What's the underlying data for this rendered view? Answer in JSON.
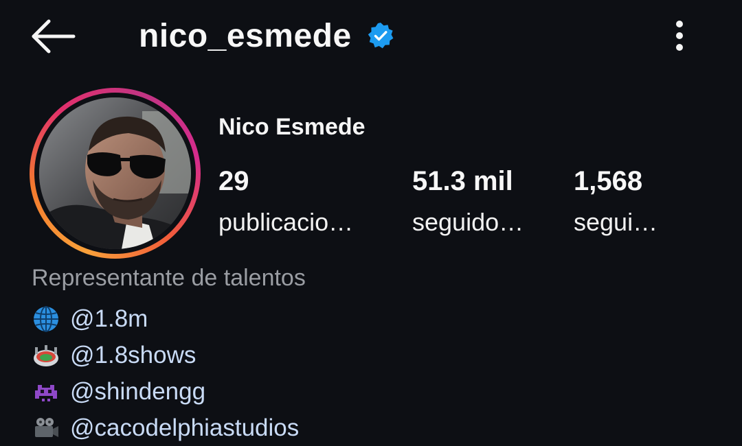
{
  "header": {
    "username": "nico_esmede"
  },
  "profile": {
    "display_name": "Nico Esmede",
    "category": "Representante de talentos"
  },
  "stats": [
    {
      "count": "29",
      "label": "publicacio…"
    },
    {
      "count": "51.3 mil",
      "label": "seguido…"
    },
    {
      "count": "1,568",
      "label": "segui…"
    }
  ],
  "bio_links": [
    {
      "icon": "globe-icon",
      "text": "@1.8m"
    },
    {
      "icon": "stadium-icon",
      "text": "@1.8shows"
    },
    {
      "icon": "space-invader-icon",
      "text": "@shindengg"
    },
    {
      "icon": "film-camera-icon",
      "text": "@cacodelphiastudios"
    }
  ],
  "colors": {
    "background": "#0d0f14",
    "verified": "#1d9bf0",
    "link": "#c9dbf6",
    "category": "#9a9da3"
  }
}
